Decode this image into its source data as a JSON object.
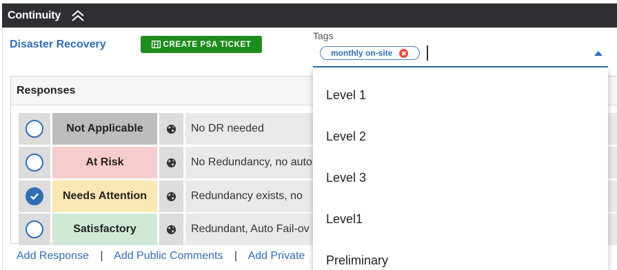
{
  "header": {
    "title": "Continuity"
  },
  "section": {
    "title": "Disaster Recovery"
  },
  "psa_button": {
    "label": "CREATE PSA TICKET"
  },
  "tags": {
    "label": "Tags",
    "chips": [
      {
        "label": "monthly on-site"
      }
    ]
  },
  "responses": {
    "heading": "Responses",
    "rows": [
      {
        "label": "Not Applicable",
        "text": "No DR needed",
        "selected": false,
        "color": "#bdbdbd"
      },
      {
        "label": "At Risk",
        "text": "No Redundancy, no auto",
        "selected": false,
        "color": "#f7cccc"
      },
      {
        "label": "Needs Attention",
        "text": "Redundancy exists, no",
        "selected": true,
        "color": "#fbe7b3"
      },
      {
        "label": "Satisfactory",
        "text": "Redundant, Auto Fail-ov",
        "selected": false,
        "color": "#cfe9d6"
      }
    ]
  },
  "links": {
    "add_response": "Add Response",
    "add_public_comments": "Add Public Comments",
    "add_private": "Add Private",
    "separator": "|"
  },
  "dropdown": {
    "options": [
      "Level 1",
      "Level 2",
      "Level 3",
      "Level1",
      "Preliminary"
    ]
  },
  "colors": {
    "accent": "#2f6eb5",
    "header_bg": "#2d2f33",
    "button_green": "#1e8d1e",
    "chip_remove": "#e74c3c"
  }
}
